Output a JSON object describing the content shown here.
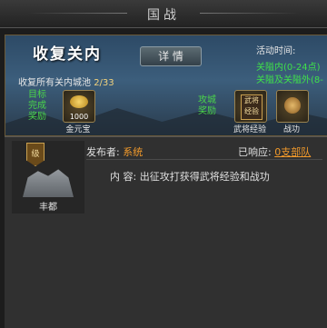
{
  "window": {
    "title": "国战"
  },
  "event": {
    "title": "收复关内",
    "detail_button": "详 情",
    "subtitle_prefix": "收复所有关内城池",
    "progress": "2/33",
    "time_label": "活动时间:",
    "time_line1": "关隘内(0-24点)",
    "time_line2": "关隘及关隘外(8-"
  },
  "target_reward": {
    "label_line1": "目标",
    "label_line2": "完成",
    "label_line3": "奖励",
    "item_qty": "1000",
    "item_name": "金元宝"
  },
  "attack_reward": {
    "label_line1": "攻城",
    "label_line2": "奖励",
    "item1_icon_text": "武将经验",
    "item1_name": "武将经验",
    "item2_name": "战功"
  },
  "city": {
    "name": "丰都",
    "level_badge": "级"
  },
  "announcement": {
    "publisher_label": "发布者:",
    "publisher": "系统",
    "responded_label": "已响应:",
    "responded_value": "0支部队",
    "content_label": "内 容:",
    "content": "出征攻打获得武将经验和战功"
  }
}
